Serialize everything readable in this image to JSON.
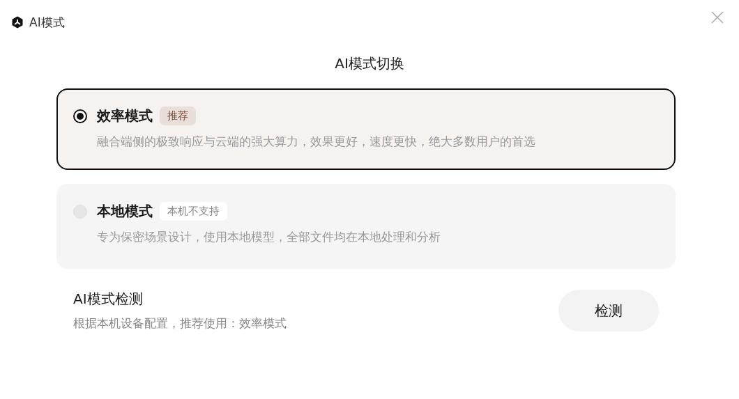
{
  "window": {
    "title": "AI模式"
  },
  "heading": "AI模式切换",
  "modes": [
    {
      "name": "效率模式",
      "badge": {
        "text": "推荐",
        "kind": "recommend"
      },
      "description": "融合端侧的极致响应与云端的强大算力，效果更好，速度更快，绝大多数用户的首选",
      "selected": true,
      "disabled": false
    },
    {
      "name": "本地模式",
      "badge": {
        "text": "本机不支持",
        "kind": "unsupported"
      },
      "description": "专为保密场景设计，使用本地模型，全部文件均在本地处理和分析",
      "selected": false,
      "disabled": true
    }
  ],
  "detection": {
    "title": "AI模式检测",
    "hint": "根据本机设备配置，推荐使用：效率模式",
    "button": "检测"
  }
}
